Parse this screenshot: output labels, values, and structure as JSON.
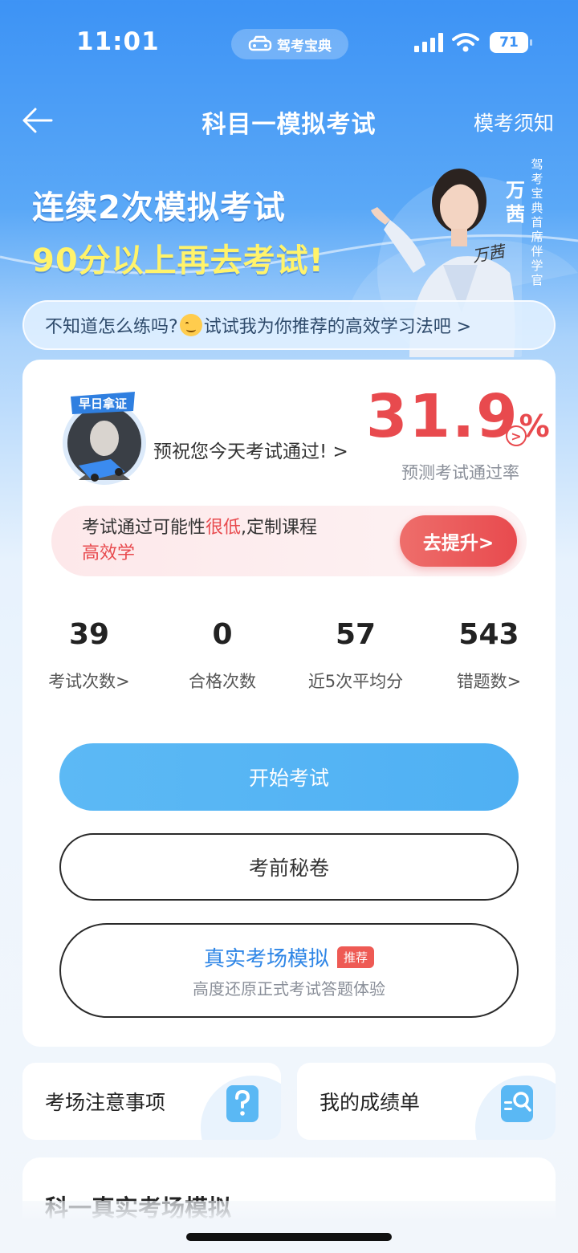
{
  "status_bar": {
    "time": "11:01",
    "app_pill_label": "驾考宝典",
    "battery": "71"
  },
  "nav": {
    "title": "科目一模拟考试",
    "right_label": "模考须知"
  },
  "banner": {
    "line1": "连续2次模拟考试",
    "line2": "90分以上再去考试!",
    "person_name": "万茜",
    "person_title": "驾考宝典首席伴学官",
    "signature": "万茜"
  },
  "tip": {
    "text_before": "不知道怎么练吗?",
    "text_after": "试试我为你推荐的高效学习法吧 >"
  },
  "prediction": {
    "badge_text": "早日拿证",
    "wish": "预祝您今天考试通过!  >",
    "rate_number": "31.9",
    "rate_unit": "%",
    "rate_arrow": ">",
    "rate_label": "预测考试通过率"
  },
  "warning": {
    "text_prefix": "考试通过可能性",
    "text_highlight": "很低",
    "text_mid": ",定制课程",
    "text_highlight2": "高效学",
    "button": "去提升>"
  },
  "stats": [
    {
      "value": "39",
      "label": "考试次数>"
    },
    {
      "value": "0",
      "label": "合格次数"
    },
    {
      "value": "57",
      "label": "近5次平均分"
    },
    {
      "value": "543",
      "label": "错题数>"
    }
  ],
  "buttons": {
    "start": "开始考试",
    "secret": "考前秘卷",
    "real_title": "真实考场模拟",
    "real_tag": "推荐",
    "real_sub": "高度还原正式考试答题体验"
  },
  "tiles": {
    "notice": "考场注意事项",
    "report": "我的成绩单"
  },
  "bottom": {
    "title": "科一真实考场模拟"
  },
  "colors": {
    "primary_blue": "#3d93f5",
    "accent_red": "#e84a4e",
    "start_button": "#5cb9f5",
    "banner_yellow": "#fff36b"
  }
}
